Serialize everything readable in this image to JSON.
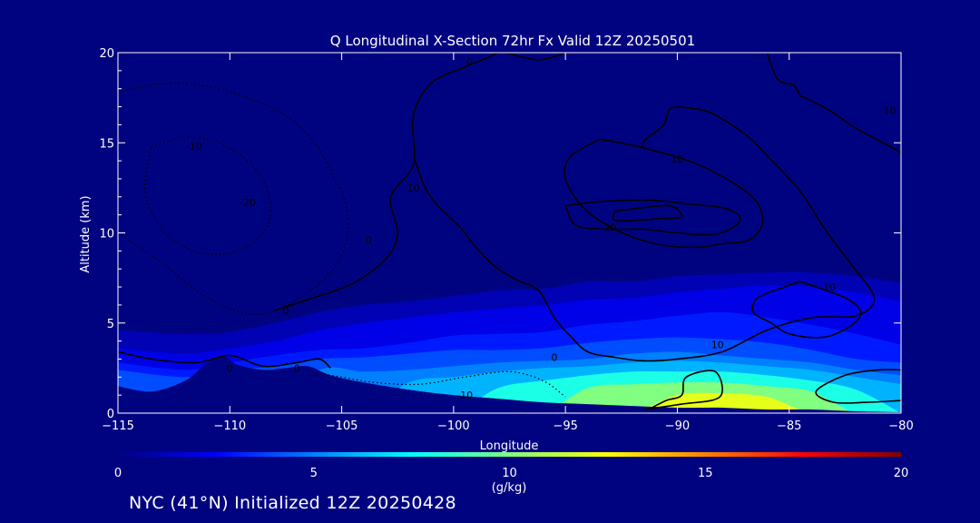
{
  "chart_data": {
    "type": "heatmap",
    "title": "Q Longitudinal X-Section 72hr  Fx Valid 12Z 20250501",
    "xlabel": "Longitude",
    "ylabel": "Altitude (km)",
    "xlim": [
      -115,
      -80
    ],
    "ylim": [
      0,
      20
    ],
    "x_ticks": [
      "−115",
      "−110",
      "−105",
      "−100",
      "−95",
      "−90",
      "−85",
      "−80"
    ],
    "y_ticks": [
      "0",
      "5",
      "10",
      "15",
      "20"
    ],
    "background_color": "#000380",
    "colorbar": {
      "min": 0,
      "max": 20,
      "ticks": [
        "0",
        "5",
        "10",
        "15",
        "20"
      ],
      "label": "(g/kg)",
      "colors": [
        "#000380",
        "#0000ff",
        "#0080ff",
        "#00ffff",
        "#80ff80",
        "#ffff00",
        "#ff8000",
        "#ff0000",
        "#800000"
      ]
    },
    "moisture_field": {
      "longitudes": [
        -115,
        -112,
        -110,
        -108,
        -106,
        -104,
        -102,
        -100,
        -98,
        -96,
        -94,
        -92,
        -90,
        -88,
        -86,
        -84,
        -82,
        -80
      ],
      "layers": [
        {
          "q": 1,
          "top_km": [
            4.6,
            4.4,
            4.5,
            5.0,
            5.6,
            6.0,
            6.2,
            6.5,
            6.8,
            6.9,
            7.3,
            7.3,
            7.6,
            7.7,
            7.8,
            7.8,
            7.6,
            7.2
          ]
        },
        {
          "q": 2,
          "top_km": [
            3.6,
            3.3,
            3.6,
            4.0,
            4.6,
            5.0,
            5.3,
            5.6,
            5.8,
            6.0,
            6.3,
            6.4,
            6.7,
            6.9,
            7.1,
            7.0,
            6.7,
            6.2
          ]
        },
        {
          "q": 3,
          "top_km": [
            2.8,
            2.4,
            2.8,
            3.2,
            3.5,
            3.6,
            3.9,
            4.3,
            4.4,
            4.5,
            4.9,
            5.1,
            5.4,
            5.6,
            5.3,
            4.9,
            4.4,
            3.8
          ]
        },
        {
          "q": 4,
          "top_km": [
            2.4,
            2.0,
            2.4,
            2.6,
            3.0,
            3.1,
            3.3,
            3.5,
            3.5,
            3.6,
            3.9,
            4.1,
            4.2,
            4.1,
            3.9,
            3.5,
            3.0,
            2.8
          ]
        },
        {
          "q": 5,
          "top_km": [
            0,
            0,
            0,
            0,
            2.4,
            2.3,
            2.4,
            2.6,
            2.8,
            2.9,
            3.0,
            3.3,
            3.4,
            3.2,
            3.0,
            2.8,
            2.4,
            2.1
          ]
        },
        {
          "q": 6,
          "top_km": [
            0,
            0,
            0,
            0,
            0,
            0,
            1.7,
            2.0,
            2.3,
            2.5,
            2.6,
            2.8,
            2.9,
            2.8,
            2.6,
            2.4,
            2.0,
            1.6
          ]
        },
        {
          "q": 8,
          "top_km": [
            0,
            0,
            0,
            0,
            0,
            0,
            0,
            0,
            1.4,
            1.8,
            2.1,
            2.3,
            2.3,
            2.3,
            2.1,
            1.8,
            1.3,
            0
          ]
        },
        {
          "q": 10,
          "top_km": [
            0,
            0,
            0,
            0,
            0,
            0,
            0,
            0,
            0,
            0,
            1.4,
            1.6,
            1.7,
            1.7,
            1.5,
            1.2,
            0,
            0
          ]
        },
        {
          "q": 12,
          "top_km": [
            0,
            0,
            0,
            0,
            0,
            0,
            0,
            0,
            0,
            0,
            0,
            0,
            1.0,
            1.1,
            0.9,
            0,
            0,
            0
          ]
        }
      ]
    },
    "terrain": {
      "longitudes": [
        -115,
        -113.5,
        -112,
        -111,
        -110.3,
        -109.7,
        -108.5,
        -107.5,
        -106.5,
        -105.5,
        -104,
        -102,
        -100,
        -98,
        -96,
        -94,
        -92,
        -90,
        -88,
        -86,
        -84,
        -82,
        -80
      ],
      "height_km": [
        1.5,
        1.2,
        1.8,
        2.8,
        3.2,
        2.7,
        2.4,
        2.5,
        2.6,
        2.1,
        1.7,
        1.3,
        1.0,
        0.8,
        0.6,
        0.5,
        0.4,
        0.3,
        0.3,
        0.2,
        0.2,
        0.1,
        0.05
      ]
    },
    "wind_contours": {
      "solid": [
        {
          "value": "10",
          "lon": [
            -115,
            -113.5,
            -111.5,
            -110,
            -108.5,
            -107,
            -106,
            -105.5
          ],
          "alt": [
            3.4,
            3.0,
            2.8,
            3.2,
            2.6,
            2.8,
            3.0,
            2.5
          ]
        },
        {
          "value": "0",
          "lon": [
            -108,
            -106.5,
            -104.5,
            -103,
            -102.5,
            -102.8,
            -101.8,
            -101.8,
            -101,
            -99.5,
            -98.5,
            -97.8,
            -96.2,
            -95
          ],
          "alt": [
            5.7,
            6.3,
            7.2,
            8.6,
            10.0,
            12.0,
            13.8,
            16.5,
            18.3,
            19.2,
            19.7,
            20.0,
            19.6,
            20.0
          ]
        },
        {
          "value": "10",
          "lon": [
            -86,
            -85.5,
            -84.8,
            -84.5,
            -84.3,
            -83.2,
            -82.0,
            -80.2,
            -80.0
          ],
          "alt": [
            20.0,
            18.5,
            18.2,
            17.6,
            17.5,
            16.8,
            15.8,
            14.6,
            14.4
          ]
        },
        {
          "value": "10",
          "lon": [
            -101.8,
            -101.3,
            -100.7,
            -99.7,
            -99,
            -98.2,
            -97.2,
            -96.2,
            -95.5,
            -94.8,
            -94,
            -92.8,
            -91.5,
            -90,
            -88,
            -86,
            -84,
            -82,
            -81.2,
            -82.2,
            -83.4,
            -84.5,
            -86,
            -87,
            -88.4,
            -89.3,
            -90.3,
            -90.6,
            -91.4,
            -91.6
          ],
          "alt": [
            14.3,
            12.6,
            11.5,
            10.3,
            9.2,
            8.2,
            7.4,
            6.8,
            5.3,
            4.3,
            3.4,
            3.1,
            2.9,
            3.0,
            3.4,
            4.6,
            5.3,
            5.4,
            6.4,
            8.2,
            10.2,
            12.3,
            14.3,
            15.5,
            16.6,
            16.9,
            16.9,
            16.0,
            15.2,
            14.7
          ]
        },
        {
          "value": "20",
          "lon": [
            -93.5,
            -94.8,
            -95.0,
            -94.2,
            -92.8,
            -91.0,
            -89.2,
            -88.0,
            -86.8,
            -86.2,
            -86.5,
            -87.8,
            -89.5,
            -91.8,
            -93.5
          ],
          "alt": [
            15.2,
            14.2,
            13.0,
            11.4,
            10.2,
            9.4,
            9.2,
            9.4,
            9.6,
            10.5,
            11.8,
            13.0,
            14.0,
            14.8,
            15.2
          ]
        },
        {
          "value": "20",
          "lon": [
            -95.0,
            -93.8,
            -92.5,
            -91,
            -89.5,
            -88.0,
            -87.2,
            -87.5,
            -88.5,
            -90,
            -91.5,
            -93,
            -94.5,
            -95.0
          ],
          "alt": [
            11.5,
            11.7,
            11.8,
            11.8,
            11.6,
            11.4,
            10.9,
            10.3,
            9.9,
            10.0,
            10.2,
            10.2,
            10.4,
            11.5
          ]
        },
        {
          "value": "30",
          "lon": [
            -92.8,
            -91.5,
            -90.3,
            -89.8,
            -90.6,
            -91.8,
            -92.8,
            -92.8
          ],
          "alt": [
            11.2,
            11.4,
            11.5,
            10.9,
            10.8,
            10.7,
            10.7,
            11.2
          ]
        },
        {
          "value": "10",
          "lon": [
            -84.5,
            -82.5,
            -81.8,
            -82.3,
            -83.5,
            -85.0,
            -85.8,
            -86.6,
            -86.4,
            -85.2,
            -84.5
          ],
          "alt": [
            7.3,
            6.4,
            5.6,
            4.8,
            4.2,
            4.4,
            5.0,
            5.6,
            6.4,
            7.0,
            7.3
          ]
        },
        {
          "value": "10",
          "lon": [
            -91.3,
            -90.5,
            -89.8,
            -89.6,
            -88.3,
            -88.1,
            -89.8,
            -91.5
          ],
          "alt": [
            0.2,
            0.7,
            1.0,
            2.0,
            2.3,
            0.9,
            0.5,
            0.2
          ]
        },
        {
          "value": "10",
          "lon": [
            -80.0,
            -81.5,
            -83.0,
            -83.8,
            -82.5,
            -81.0,
            -80.0
          ],
          "alt": [
            0.7,
            0.6,
            0.6,
            1.2,
            2.1,
            2.4,
            2.4
          ]
        }
      ],
      "dashed": [
        {
          "value": "-10",
          "lon": [
            -115,
            -113.5,
            -112,
            -110.5,
            -109,
            -107.5,
            -106.2,
            -105.4,
            -104.8,
            -104.8,
            -105.5,
            -107,
            -108.5,
            -110,
            -111.5,
            -113,
            -115
          ],
          "alt": [
            17.8,
            18.2,
            18.3,
            18.0,
            17.4,
            16.5,
            15.0,
            13.2,
            11.5,
            9.5,
            7.8,
            6.3,
            5.5,
            5.8,
            6.8,
            8.3,
            10.0
          ]
        },
        {
          "value": "-20",
          "lon": [
            -113.5,
            -112,
            -110.5,
            -109.2,
            -108.4,
            -108.2,
            -109,
            -110.5,
            -112,
            -113.2,
            -113.8,
            -113.5
          ],
          "alt": [
            14.8,
            15.3,
            15.0,
            14.0,
            12.6,
            10.8,
            9.4,
            8.8,
            9.2,
            10.5,
            12.5,
            14.8
          ]
        },
        {
          "value": "-10",
          "lon": [
            -106.5,
            -105,
            -103.5,
            -101.5,
            -99.5,
            -97.5,
            -96,
            -95
          ],
          "alt": [
            2.3,
            2.0,
            1.7,
            1.6,
            2.0,
            2.3,
            1.8,
            0.9
          ]
        }
      ]
    },
    "contour_labels": [
      {
        "text": "0",
        "lon": -99.3,
        "alt": 19.5
      },
      {
        "text": "-10",
        "lon": -111.6,
        "alt": 14.8
      },
      {
        "text": "-20",
        "lon": -109.2,
        "alt": 11.7
      },
      {
        "text": "10",
        "lon": -101.8,
        "alt": 12.5
      },
      {
        "text": "0",
        "lon": -103.8,
        "alt": 9.6
      },
      {
        "text": "0",
        "lon": -107.5,
        "alt": 5.7
      },
      {
        "text": "10",
        "lon": -90.0,
        "alt": 14.1
      },
      {
        "text": "20",
        "lon": -93.0,
        "alt": 10.3
      },
      {
        "text": "10",
        "lon": -88.2,
        "alt": 3.8
      },
      {
        "text": "10",
        "lon": -83.2,
        "alt": 7.0
      },
      {
        "text": "0",
        "lon": -95.5,
        "alt": 3.1
      },
      {
        "text": "-10",
        "lon": -99.5,
        "alt": 1.0
      },
      {
        "text": "0",
        "lon": -110.0,
        "alt": 2.5
      },
      {
        "text": "0",
        "lon": -107.0,
        "alt": 2.5
      },
      {
        "text": "10",
        "lon": -80.5,
        "alt": 16.8
      }
    ]
  },
  "footer_text": "NYC (41°N) Initialized 12Z 20250428"
}
